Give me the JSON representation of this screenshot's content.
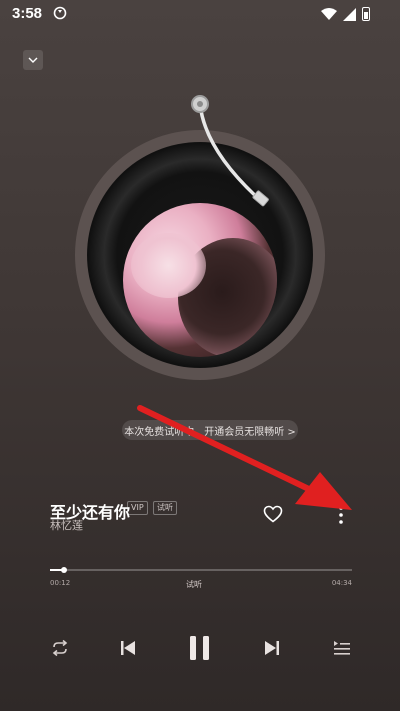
{
  "status_bar": {
    "time": "3:58"
  },
  "player": {
    "tip": "本次免费试听中，开通会员无限畅听 >",
    "song_title": "至少还有你",
    "badges": [
      "VIP",
      "试听"
    ],
    "artist": "林忆莲",
    "progress": {
      "elapsed": "00:12",
      "duration": "04:34",
      "label": "试听",
      "fraction": 0.047
    }
  },
  "icons": {
    "collapse": "chevron-down-icon",
    "like": "heart-icon",
    "more": "more-vertical-icon",
    "repeat": "repeat-icon",
    "previous": "skip-previous-icon",
    "pause": "pause-icon",
    "next": "skip-next-icon",
    "playlist": "playlist-icon"
  },
  "colors": {
    "annotation_arrow": "#e02020"
  }
}
